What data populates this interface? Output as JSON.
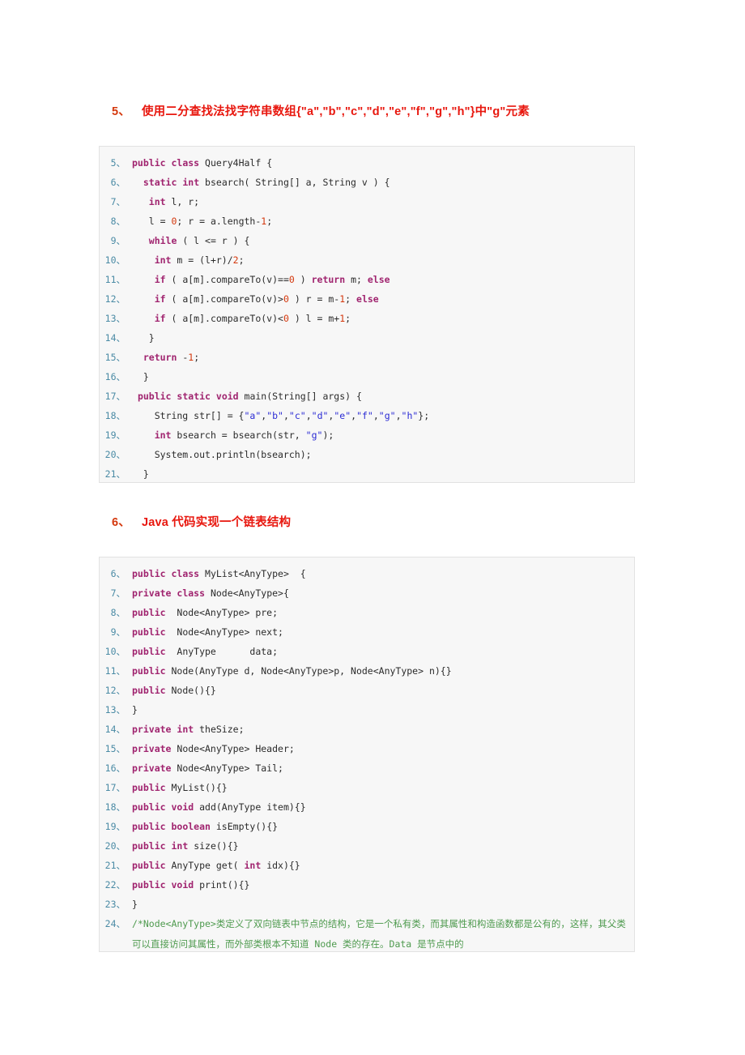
{
  "document": {
    "sections": [
      {
        "number": "5、",
        "title": "使用二分查找法找字符串数组{\"a\",\"b\",\"c\",\"d\",\"e\",\"f\",\"g\",\"h\"}中\"g\"元素",
        "language": "java",
        "lines": [
          {
            "n": "5、",
            "tokens": [
              {
                "t": "public",
                "c": "kw"
              },
              {
                "t": " ",
                "c": ""
              },
              {
                "t": "class",
                "c": "kw"
              },
              {
                "t": " Query4Half {",
                "c": ""
              }
            ]
          },
          {
            "n": "6、",
            "tokens": [
              {
                "t": "  ",
                "c": ""
              },
              {
                "t": "static",
                "c": "kw"
              },
              {
                "t": " ",
                "c": ""
              },
              {
                "t": "int",
                "c": "kw"
              },
              {
                "t": " bsearch( String[] a, String v ) {",
                "c": ""
              }
            ]
          },
          {
            "n": "7、",
            "tokens": [
              {
                "t": "   ",
                "c": ""
              },
              {
                "t": "int",
                "c": "kw"
              },
              {
                "t": " l, r;",
                "c": ""
              }
            ]
          },
          {
            "n": "8、",
            "tokens": [
              {
                "t": "   l = ",
                "c": ""
              },
              {
                "t": "0",
                "c": "num"
              },
              {
                "t": "; r = a.length-",
                "c": ""
              },
              {
                "t": "1",
                "c": "num"
              },
              {
                "t": ";",
                "c": ""
              }
            ]
          },
          {
            "n": "9、",
            "tokens": [
              {
                "t": "   ",
                "c": ""
              },
              {
                "t": "while",
                "c": "kw"
              },
              {
                "t": " ( l <= r ) {",
                "c": ""
              }
            ]
          },
          {
            "n": "10、",
            "tokens": [
              {
                "t": "    ",
                "c": ""
              },
              {
                "t": "int",
                "c": "kw"
              },
              {
                "t": " m = (l+r)/",
                "c": ""
              },
              {
                "t": "2",
                "c": "num"
              },
              {
                "t": ";",
                "c": ""
              }
            ]
          },
          {
            "n": "11、",
            "tokens": [
              {
                "t": "    ",
                "c": ""
              },
              {
                "t": "if",
                "c": "kw"
              },
              {
                "t": " ( a[m].compareTo(v)==",
                "c": ""
              },
              {
                "t": "0",
                "c": "num"
              },
              {
                "t": " ) ",
                "c": ""
              },
              {
                "t": "return",
                "c": "kw"
              },
              {
                "t": " m; ",
                "c": ""
              },
              {
                "t": "else",
                "c": "kw"
              }
            ]
          },
          {
            "n": "12、",
            "tokens": [
              {
                "t": "    ",
                "c": ""
              },
              {
                "t": "if",
                "c": "kw"
              },
              {
                "t": " ( a[m].compareTo(v)>",
                "c": ""
              },
              {
                "t": "0",
                "c": "num"
              },
              {
                "t": " ) r = m-",
                "c": ""
              },
              {
                "t": "1",
                "c": "num"
              },
              {
                "t": "; ",
                "c": ""
              },
              {
                "t": "else",
                "c": "kw"
              }
            ]
          },
          {
            "n": "13、",
            "tokens": [
              {
                "t": "    ",
                "c": ""
              },
              {
                "t": "if",
                "c": "kw"
              },
              {
                "t": " ( a[m].compareTo(v)<",
                "c": ""
              },
              {
                "t": "0",
                "c": "num"
              },
              {
                "t": " ) l = m+",
                "c": ""
              },
              {
                "t": "1",
                "c": "num"
              },
              {
                "t": ";",
                "c": ""
              }
            ]
          },
          {
            "n": "14、",
            "tokens": [
              {
                "t": "   }",
                "c": ""
              }
            ]
          },
          {
            "n": "15、",
            "tokens": [
              {
                "t": "  ",
                "c": ""
              },
              {
                "t": "return",
                "c": "kw"
              },
              {
                "t": " -",
                "c": ""
              },
              {
                "t": "1",
                "c": "num"
              },
              {
                "t": ";",
                "c": ""
              }
            ]
          },
          {
            "n": "16、",
            "tokens": [
              {
                "t": "  }",
                "c": ""
              }
            ]
          },
          {
            "n": "17、",
            "tokens": [
              {
                "t": " ",
                "c": ""
              },
              {
                "t": "public",
                "c": "kw"
              },
              {
                "t": " ",
                "c": ""
              },
              {
                "t": "static",
                "c": "kw"
              },
              {
                "t": " ",
                "c": ""
              },
              {
                "t": "void",
                "c": "kw"
              },
              {
                "t": " main(String[] args) {",
                "c": ""
              }
            ]
          },
          {
            "n": "18、",
            "tokens": [
              {
                "t": "    String str[] = {",
                "c": ""
              },
              {
                "t": "\"a\"",
                "c": "str"
              },
              {
                "t": ",",
                "c": ""
              },
              {
                "t": "\"b\"",
                "c": "str"
              },
              {
                "t": ",",
                "c": ""
              },
              {
                "t": "\"c\"",
                "c": "str"
              },
              {
                "t": ",",
                "c": ""
              },
              {
                "t": "\"d\"",
                "c": "str"
              },
              {
                "t": ",",
                "c": ""
              },
              {
                "t": "\"e\"",
                "c": "str"
              },
              {
                "t": ",",
                "c": ""
              },
              {
                "t": "\"f\"",
                "c": "str"
              },
              {
                "t": ",",
                "c": ""
              },
              {
                "t": "\"g\"",
                "c": "str"
              },
              {
                "t": ",",
                "c": ""
              },
              {
                "t": "\"h\"",
                "c": "str"
              },
              {
                "t": "};",
                "c": ""
              }
            ]
          },
          {
            "n": "19、",
            "tokens": [
              {
                "t": "    ",
                "c": ""
              },
              {
                "t": "int",
                "c": "kw"
              },
              {
                "t": " bsearch = bsearch(str, ",
                "c": ""
              },
              {
                "t": "\"g\"",
                "c": "str"
              },
              {
                "t": ");",
                "c": ""
              }
            ]
          },
          {
            "n": "20、",
            "tokens": [
              {
                "t": "    System.out.println(bsearch);",
                "c": ""
              }
            ]
          },
          {
            "n": "21、",
            "tokens": [
              {
                "t": "  }",
                "c": ""
              }
            ]
          }
        ]
      },
      {
        "number": "6、",
        "title": "Java 代码实现一个链表结构",
        "language": "java",
        "lines": [
          {
            "n": "6、",
            "tokens": [
              {
                "t": "public",
                "c": "kw"
              },
              {
                "t": " ",
                "c": ""
              },
              {
                "t": "class",
                "c": "kw"
              },
              {
                "t": " MyList<AnyType>  {",
                "c": ""
              }
            ]
          },
          {
            "n": "7、",
            "tokens": [
              {
                "t": "private",
                "c": "kw"
              },
              {
                "t": " ",
                "c": ""
              },
              {
                "t": "class",
                "c": "kw"
              },
              {
                "t": " Node<AnyType>{",
                "c": ""
              }
            ]
          },
          {
            "n": "8、",
            "tokens": [
              {
                "t": "public",
                "c": "kw"
              },
              {
                "t": "  Node<AnyType> pre;",
                "c": ""
              }
            ]
          },
          {
            "n": "9、",
            "tokens": [
              {
                "t": "public",
                "c": "kw"
              },
              {
                "t": "  Node<AnyType> next;",
                "c": ""
              }
            ]
          },
          {
            "n": "10、",
            "tokens": [
              {
                "t": "public",
                "c": "kw"
              },
              {
                "t": "  AnyType      data;",
                "c": ""
              }
            ]
          },
          {
            "n": "11、",
            "tokens": [
              {
                "t": "public",
                "c": "kw"
              },
              {
                "t": " Node(AnyType d, Node<AnyType>p, Node<AnyType> n){}",
                "c": ""
              }
            ]
          },
          {
            "n": "12、",
            "tokens": [
              {
                "t": "public",
                "c": "kw"
              },
              {
                "t": " Node(){}",
                "c": ""
              }
            ]
          },
          {
            "n": "13、",
            "tokens": [
              {
                "t": "}",
                "c": ""
              }
            ]
          },
          {
            "n": "14、",
            "tokens": [
              {
                "t": "private",
                "c": "kw"
              },
              {
                "t": " ",
                "c": ""
              },
              {
                "t": "int",
                "c": "kw"
              },
              {
                "t": " theSize;",
                "c": ""
              }
            ]
          },
          {
            "n": "15、",
            "tokens": [
              {
                "t": "private",
                "c": "kw"
              },
              {
                "t": " Node<AnyType> Header;",
                "c": ""
              }
            ]
          },
          {
            "n": "16、",
            "tokens": [
              {
                "t": "private",
                "c": "kw"
              },
              {
                "t": " Node<AnyType> Tail;",
                "c": ""
              }
            ]
          },
          {
            "n": "17、",
            "tokens": [
              {
                "t": "public",
                "c": "kw"
              },
              {
                "t": " MyList(){}",
                "c": ""
              }
            ]
          },
          {
            "n": "18、",
            "tokens": [
              {
                "t": "public",
                "c": "kw"
              },
              {
                "t": " ",
                "c": ""
              },
              {
                "t": "void",
                "c": "kw"
              },
              {
                "t": " add(AnyType item){}",
                "c": ""
              }
            ]
          },
          {
            "n": "19、",
            "tokens": [
              {
                "t": "public",
                "c": "kw"
              },
              {
                "t": " ",
                "c": ""
              },
              {
                "t": "boolean",
                "c": "kw"
              },
              {
                "t": " isEmpty(){}",
                "c": ""
              }
            ]
          },
          {
            "n": "20、",
            "tokens": [
              {
                "t": "public",
                "c": "kw"
              },
              {
                "t": " ",
                "c": ""
              },
              {
                "t": "int",
                "c": "kw"
              },
              {
                "t": " size(){}",
                "c": ""
              }
            ]
          },
          {
            "n": "21、",
            "tokens": [
              {
                "t": "public",
                "c": "kw"
              },
              {
                "t": " AnyType get( ",
                "c": ""
              },
              {
                "t": "int",
                "c": "kw"
              },
              {
                "t": " idx){}",
                "c": ""
              }
            ]
          },
          {
            "n": "22、",
            "tokens": [
              {
                "t": "public",
                "c": "kw"
              },
              {
                "t": " ",
                "c": ""
              },
              {
                "t": "void",
                "c": "kw"
              },
              {
                "t": " print(){}",
                "c": ""
              }
            ]
          },
          {
            "n": "23、",
            "tokens": [
              {
                "t": "}",
                "c": ""
              }
            ]
          },
          {
            "n": "24、",
            "wrap": true,
            "tokens": [
              {
                "t": "/*Node<AnyType>类定义了双向链表中节点的结构，它是一个私有类，而其属性和构造函数都是公有的，这样，其父类可以直接访问其属性，而外部类根本不知道 Node 类的存在。Data 是节点中的",
                "c": "cm"
              }
            ]
          }
        ]
      }
    ]
  },
  "colors": {
    "heading": "#e8170e",
    "keyword": "#a0246f",
    "string": "#2b2bd4",
    "number": "#d4380d",
    "comment": "#4e9a4e",
    "line_number": "#4b8ba5",
    "code_background": "#f7f7f7",
    "code_border": "#e2e2e2",
    "page_background": "#ffffff"
  }
}
